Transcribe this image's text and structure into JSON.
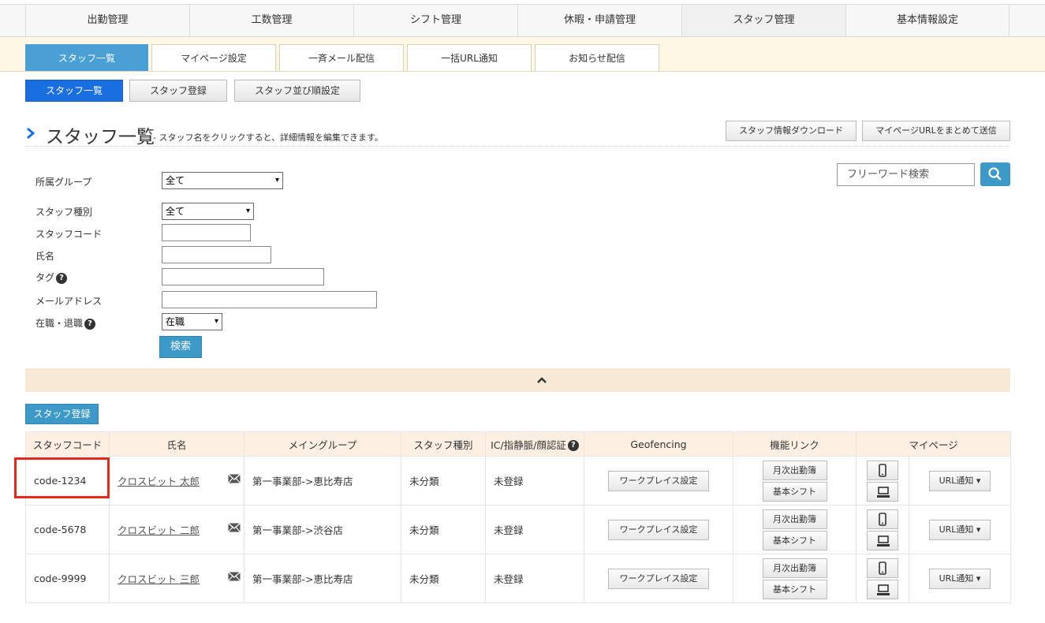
{
  "top_nav": [
    "出勤管理",
    "工数管理",
    "シフト管理",
    "休暇・申請管理",
    "スタッフ管理",
    "基本情報設定"
  ],
  "sub_nav": [
    "スタッフ一覧",
    "マイページ設定",
    "一斉メール配信",
    "一括URL通知",
    "お知らせ配信"
  ],
  "action_bar": {
    "staff_list": "スタッフ一覧",
    "staff_register": "スタッフ登録",
    "staff_order": "スタッフ並び順設定"
  },
  "title": {
    "main": "スタッフ一覧",
    "sub": "- スタッフ名をクリックすると、詳細情報を編集できます。",
    "download": "スタッフ情報ダウンロード",
    "send_urls": "マイページURLをまとめて送信"
  },
  "search": {
    "group_label": "所属グループ",
    "group_value": "全て",
    "type_label": "スタッフ種別",
    "type_value": "全て",
    "code_label": "スタッフコード",
    "name_label": "氏名",
    "tag_label": "タグ",
    "email_label": "メールアドレス",
    "status_label": "在職・退職",
    "status_value": "在職",
    "submit": "検索",
    "freeword_placeholder": "フリーワード検索"
  },
  "register_button": "スタッフ登録",
  "table": {
    "headers": [
      "スタッフコード",
      "氏名",
      "メイングループ",
      "スタッフ種別",
      "IC/指静脈/顔認証",
      "Geofencing",
      "機能リンク",
      "マイページ"
    ],
    "workplace_btn": "ワークプレイス設定",
    "monthly_btn": "月次出勤簿",
    "shift_btn": "基本シフト",
    "url_btn": "URL通知",
    "rows": [
      {
        "code": "code-1234",
        "name": "クロスビット 太郎",
        "group": "第一事業部->恵比寿店",
        "type": "未分類",
        "auth": "未登録"
      },
      {
        "code": "code-5678",
        "name": "クロスビット 二郎",
        "group": "第一事業部->渋谷店",
        "type": "未分類",
        "auth": "未登録"
      },
      {
        "code": "code-9999",
        "name": "クロスビット 三郎",
        "group": "第一事業部->恵比寿店",
        "type": "未分類",
        "auth": "未登録"
      }
    ]
  },
  "colors": {
    "accent_blue": "#1a6fe0",
    "button_blue": "#3d9ac8",
    "highlight_red": "#e8281c",
    "subnav_bg": "#fdf6e3"
  }
}
